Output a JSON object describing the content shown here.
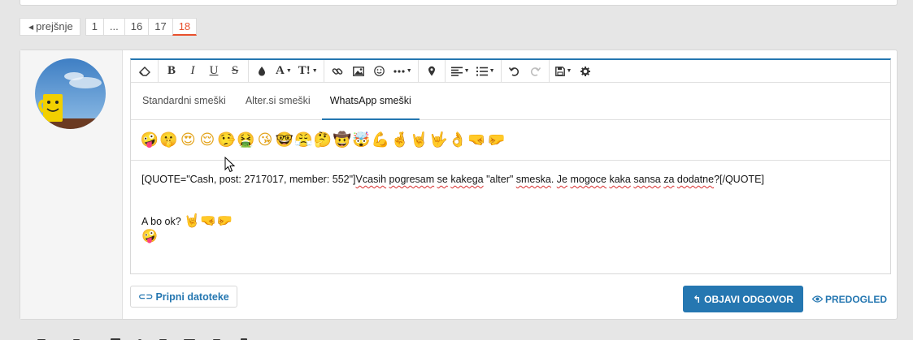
{
  "pagination": {
    "prev_label": "prejšnje",
    "pages": [
      "1",
      "...",
      "16",
      "17",
      "18"
    ],
    "current_page": "18"
  },
  "toolbar": {
    "buttons": [
      {
        "name": "eraser-icon"
      },
      {
        "name": "bold-button",
        "label": "B"
      },
      {
        "name": "italic-button",
        "label": "I"
      },
      {
        "name": "underline-button",
        "label": "U"
      },
      {
        "name": "strikethrough-button",
        "label": "S"
      },
      {
        "name": "color-icon"
      },
      {
        "name": "font-size-button",
        "label": "A"
      },
      {
        "name": "style-button",
        "label": "T!"
      },
      {
        "name": "link-icon"
      },
      {
        "name": "image-icon"
      },
      {
        "name": "smiley-icon"
      },
      {
        "name": "more-icon"
      },
      {
        "name": "map-pin-icon"
      },
      {
        "name": "align-icon"
      },
      {
        "name": "list-icon"
      },
      {
        "name": "undo-icon"
      },
      {
        "name": "redo-icon"
      },
      {
        "name": "save-icon"
      },
      {
        "name": "gear-icon"
      }
    ]
  },
  "smiley_tabs": [
    {
      "label": "Standardni smeški"
    },
    {
      "label": "Alter.si smeški"
    },
    {
      "label": "WhatsApp smeški",
      "active": true
    }
  ],
  "emojis": [
    "🤪",
    "🤫",
    "😍",
    "😌",
    "🤥",
    "🤮",
    "😘",
    "🤓",
    "😤",
    "🤔",
    "🤠",
    "🤯",
    "💪",
    "🤞",
    "🤘",
    "🤟",
    "👌",
    "🤜",
    "🤛"
  ],
  "editor": {
    "quote_prefix": "[QUOTE=\"Cash, post: 2717017, member: 552\"]",
    "quote_words": [
      {
        "t": "Vcasih",
        "err": true
      },
      {
        "t": " "
      },
      {
        "t": "pogresam",
        "err": true
      },
      {
        "t": " "
      },
      {
        "t": "se",
        "err": true
      },
      {
        "t": " "
      },
      {
        "t": "kakega",
        "err": true
      },
      {
        "t": " \"alter\" "
      },
      {
        "t": "smeska",
        "err": true
      },
      {
        "t": ". "
      },
      {
        "t": "Je",
        "err": true
      },
      {
        "t": " "
      },
      {
        "t": "mogoce",
        "err": true
      },
      {
        "t": " "
      },
      {
        "t": "kaka",
        "err": true
      },
      {
        "t": " "
      },
      {
        "t": "sansa",
        "err": true
      },
      {
        "t": " "
      },
      {
        "t": "za",
        "err": true
      },
      {
        "t": " "
      },
      {
        "t": "dodatne",
        "err": true
      },
      {
        "t": "?[/QUOTE]"
      }
    ],
    "reply_text": "A bo ok?",
    "reply_emojis": [
      "🤘",
      "🤜",
      "🤛"
    ],
    "reply_emoji_line2": "🤪"
  },
  "actions": {
    "attach_label": "Pripni datoteke",
    "post_label": "OBJAVI ODGOVOR",
    "preview_label": "PREDOGLED"
  },
  "colors": {
    "accent": "#2577b1",
    "current_page": "#e8502d",
    "spell_error": "#d92e2e"
  }
}
